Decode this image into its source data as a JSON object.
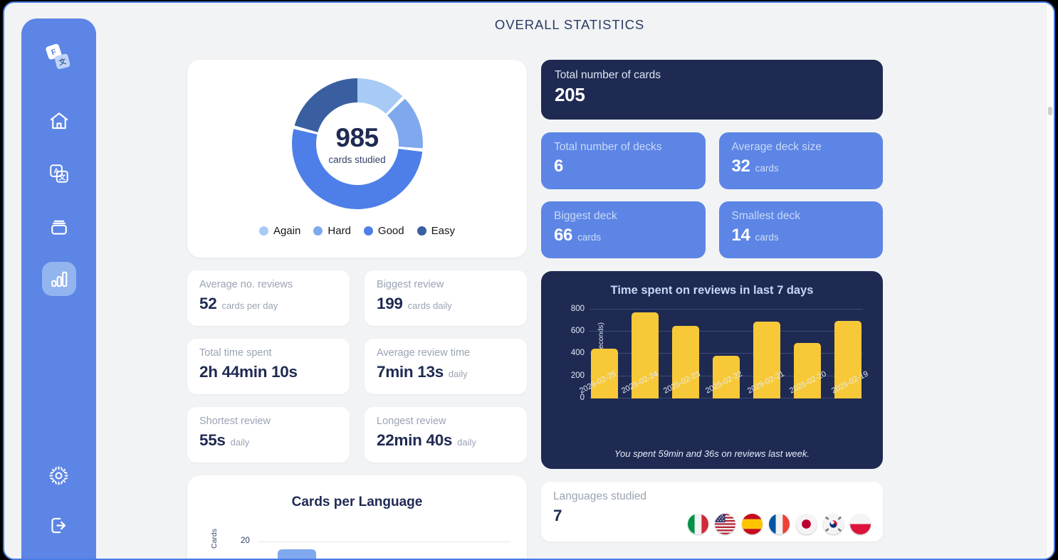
{
  "header": {
    "title": "OVERALL STATISTICS"
  },
  "sidebar": {
    "logo_name": "app-logo",
    "items": [
      {
        "name": "home",
        "icon": "home-icon",
        "active": false
      },
      {
        "name": "translate",
        "icon": "translate-icon",
        "active": false
      },
      {
        "name": "decks",
        "icon": "card-deck-icon",
        "active": false
      },
      {
        "name": "statistics",
        "icon": "bar-chart-icon",
        "active": true
      }
    ],
    "bottom_items": [
      {
        "name": "settings",
        "icon": "gear-icon"
      },
      {
        "name": "logout",
        "icon": "logout-icon"
      }
    ]
  },
  "colors": {
    "sidebar_blue": "#5C85E5",
    "active_nav": "#92B4EF",
    "navy": "#1E2A52",
    "card_blue": "#5C85E5",
    "bar_yellow": "#F7C938",
    "page_bg": "#F2F3F5",
    "again": "#A8CBF5",
    "hard": "#7FA8EE",
    "good": "#4E7FE8",
    "easy": "#3A5FA0"
  },
  "donut": {
    "center_value": "985",
    "center_label": "cards studied",
    "legend": [
      {
        "label": "Again",
        "color": "#A8CBF5",
        "percent": 12.5
      },
      {
        "label": "Hard",
        "color": "#7FA8EE",
        "percent": 13.6
      },
      {
        "label": "Good",
        "color": "#4E7FE8",
        "percent": 52.5
      },
      {
        "label": "Easy",
        "color": "#3A5FA0",
        "percent": 21.4
      }
    ]
  },
  "left_stats": [
    {
      "label": "Average no. reviews",
      "value": "52",
      "unit": "cards per day"
    },
    {
      "label": "Biggest review",
      "value": "199",
      "unit": "cards daily"
    },
    {
      "label": "Total time spent",
      "value": "2h 44min 10s",
      "unit": ""
    },
    {
      "label": "Average review time",
      "value": "7min 13s",
      "unit": "daily"
    },
    {
      "label": "Shortest review",
      "value": "55s",
      "unit": "daily"
    },
    {
      "label": "Longest review",
      "value": "22min 40s",
      "unit": "daily"
    }
  ],
  "hero": {
    "label": "Total number of cards",
    "value": "205"
  },
  "blue_stats": [
    {
      "label": "Total number of decks",
      "value": "6",
      "unit": ""
    },
    {
      "label": "Average deck size",
      "value": "32",
      "unit": "cards"
    },
    {
      "label": "Biggest deck",
      "value": "66",
      "unit": "cards"
    },
    {
      "label": "Smallest deck",
      "value": "14",
      "unit": "cards"
    }
  ],
  "languages": {
    "label": "Languages studied",
    "value": "7",
    "flags": [
      "italy",
      "usa",
      "spain",
      "france",
      "japan",
      "south-korea",
      "poland"
    ]
  },
  "chart_data": [
    {
      "type": "bar",
      "title": "Time spent on reviews in last 7 days",
      "xlabel": "",
      "ylabel": "Time (in seconds)",
      "categories": [
        "2025-02-25",
        "2025-02-24",
        "2025-02-23",
        "2025-02-22",
        "2025-02-21",
        "2025-02-20",
        "2025-02-19"
      ],
      "values": [
        445,
        775,
        650,
        385,
        690,
        500,
        695
      ],
      "yticks": [
        0,
        200,
        400,
        600,
        800
      ],
      "ylim": [
        0,
        830
      ],
      "grid": true,
      "legend": "none",
      "bar_color": "#F7C938",
      "footnote": "You spent 59min and 36s on reviews last week."
    },
    {
      "type": "bar",
      "title": "Cards per Language",
      "xlabel": "",
      "ylabel": "Cards",
      "yticks": [
        20
      ],
      "categories": [],
      "values": [],
      "grid": true,
      "legend": "none",
      "note": "clipped at bottom of viewport"
    }
  ]
}
